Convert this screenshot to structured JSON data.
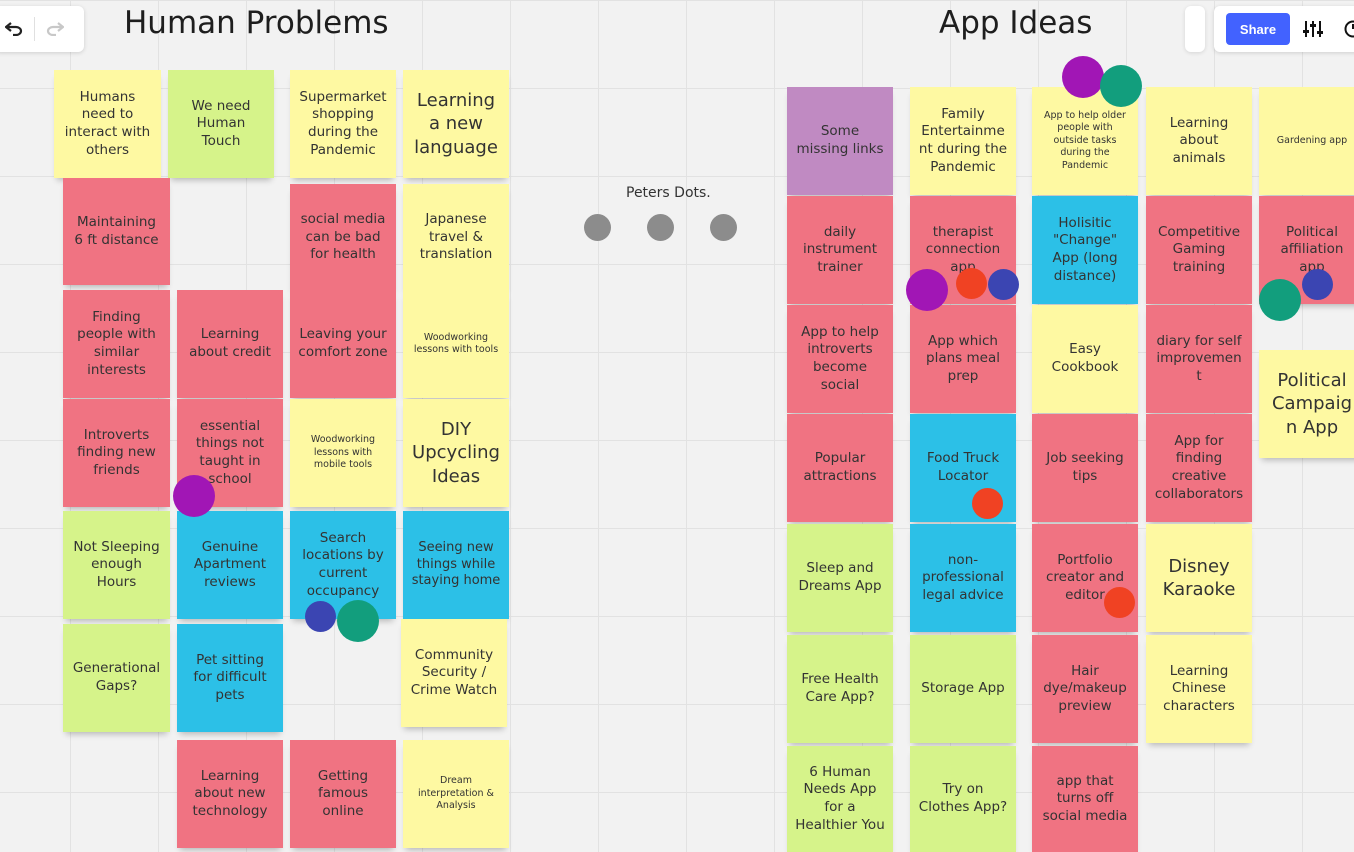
{
  "colors": {
    "yellow": "#fef9a2",
    "green": "#d6f38a",
    "pink": "#f07382",
    "blue": "#2cc0e7",
    "purple": "#c08ac2",
    "dot_purple": "#a116b5",
    "dot_teal": "#129e7d",
    "dot_red": "#f04223",
    "dot_navy": "#3b45b2",
    "dot_gray": "#8c8c8c",
    "share": "#4262ff"
  },
  "toolbar": {
    "undo_icon": "undo-icon",
    "redo_icon": "redo-icon",
    "share_label": "Share",
    "settings_icon": "sliders-icon",
    "timer_icon": "timer-icon"
  },
  "headings": {
    "human_problems": "Human Problems",
    "app_ideas": "App Ideas",
    "peters_dots": "Peters Dots."
  },
  "human_problems_notes": [
    {
      "text": "Humans need to interact with others",
      "color": "yellow"
    },
    {
      "text": "We need Human Touch",
      "color": "green"
    },
    {
      "text": "Supermarket shopping during the Pandemic",
      "color": "yellow"
    },
    {
      "text": "Learning a new language",
      "color": "yellow"
    },
    {
      "text": "Maintaining 6 ft distance",
      "color": "pink"
    },
    {
      "text": "social media can be bad for health",
      "color": "pink"
    },
    {
      "text": "Japanese travel & translation",
      "color": "yellow"
    },
    {
      "text": "Finding people with similar interests",
      "color": "pink"
    },
    {
      "text": "Learning about credit",
      "color": "pink"
    },
    {
      "text": "Leaving your comfort zone",
      "color": "pink"
    },
    {
      "text": "Woodworking lessons with tools",
      "color": "yellow"
    },
    {
      "text": "Introverts finding new friends",
      "color": "pink"
    },
    {
      "text": "essential things not taught in school",
      "color": "pink"
    },
    {
      "text": "Woodworking lessons with mobile tools",
      "color": "yellow"
    },
    {
      "text": "DIY Upcycling Ideas",
      "color": "yellow"
    },
    {
      "text": "Not Sleeping enough Hours",
      "color": "green"
    },
    {
      "text": "Genuine Apartment reviews",
      "color": "blue"
    },
    {
      "text": "Search locations by current occupancy",
      "color": "blue"
    },
    {
      "text": "Seeing new things while staying home",
      "color": "blue"
    },
    {
      "text": "Generational Gaps?",
      "color": "green"
    },
    {
      "text": "Pet sitting for difficult pets",
      "color": "blue"
    },
    {
      "text": "Community Security / Crime Watch",
      "color": "yellow"
    },
    {
      "text": "Learning about new technology",
      "color": "pink"
    },
    {
      "text": "Getting famous online",
      "color": "pink"
    },
    {
      "text": "Dream interpretation & Analysis",
      "color": "yellow"
    }
  ],
  "app_ideas_notes": [
    {
      "text": "Some missing links",
      "color": "purple"
    },
    {
      "text": "Family Entertainment during the Pandemic",
      "color": "yellow"
    },
    {
      "text": "App to help older people with outside tasks during the Pandemic",
      "color": "yellow"
    },
    {
      "text": "Learning about animals",
      "color": "yellow"
    },
    {
      "text": "Gardening app",
      "color": "yellow"
    },
    {
      "text": "daily instrument trainer",
      "color": "pink"
    },
    {
      "text": "therapist connection app",
      "color": "pink"
    },
    {
      "text": "Holisitic \"Change\" App (long distance)",
      "color": "blue"
    },
    {
      "text": "Competitive Gaming training",
      "color": "pink"
    },
    {
      "text": "Political affiliation app",
      "color": "pink"
    },
    {
      "text": "App to help introverts become social",
      "color": "pink"
    },
    {
      "text": "App which plans meal prep",
      "color": "pink"
    },
    {
      "text": "Easy Cookbook",
      "color": "yellow"
    },
    {
      "text": "diary for self improvement",
      "color": "pink"
    },
    {
      "text": "Political Campaign App",
      "color": "yellow"
    },
    {
      "text": "Popular attractions",
      "color": "pink"
    },
    {
      "text": "Food Truck Locator",
      "color": "blue"
    },
    {
      "text": "Job seeking tips",
      "color": "pink"
    },
    {
      "text": "App for finding creative collaborators",
      "color": "pink"
    },
    {
      "text": "Sleep and Dreams App",
      "color": "green"
    },
    {
      "text": "non-professional legal advice",
      "color": "blue"
    },
    {
      "text": "Portfolio creator and editor",
      "color": "pink"
    },
    {
      "text": "Disney Karaoke",
      "color": "yellow"
    },
    {
      "text": "Free Health Care App?",
      "color": "green"
    },
    {
      "text": "Storage App",
      "color": "green"
    },
    {
      "text": "Hair dye/makeup preview",
      "color": "pink"
    },
    {
      "text": "Learning Chinese characters",
      "color": "yellow"
    },
    {
      "text": "6 Human Needs App for a Healthier You",
      "color": "green"
    },
    {
      "text": "Try on Clothes App?",
      "color": "green"
    },
    {
      "text": "app that turns off social media",
      "color": "pink"
    }
  ],
  "vote_dots": [
    {
      "color": "dot_purple"
    },
    {
      "color": "dot_navy"
    },
    {
      "color": "dot_teal"
    },
    {
      "color": "dot_gray"
    },
    {
      "color": "dot_gray"
    },
    {
      "color": "dot_gray"
    },
    {
      "color": "dot_purple"
    },
    {
      "color": "dot_teal"
    },
    {
      "color": "dot_purple"
    },
    {
      "color": "dot_red"
    },
    {
      "color": "dot_navy"
    },
    {
      "color": "dot_navy"
    },
    {
      "color": "dot_teal"
    },
    {
      "color": "dot_red"
    },
    {
      "color": "dot_red"
    }
  ]
}
